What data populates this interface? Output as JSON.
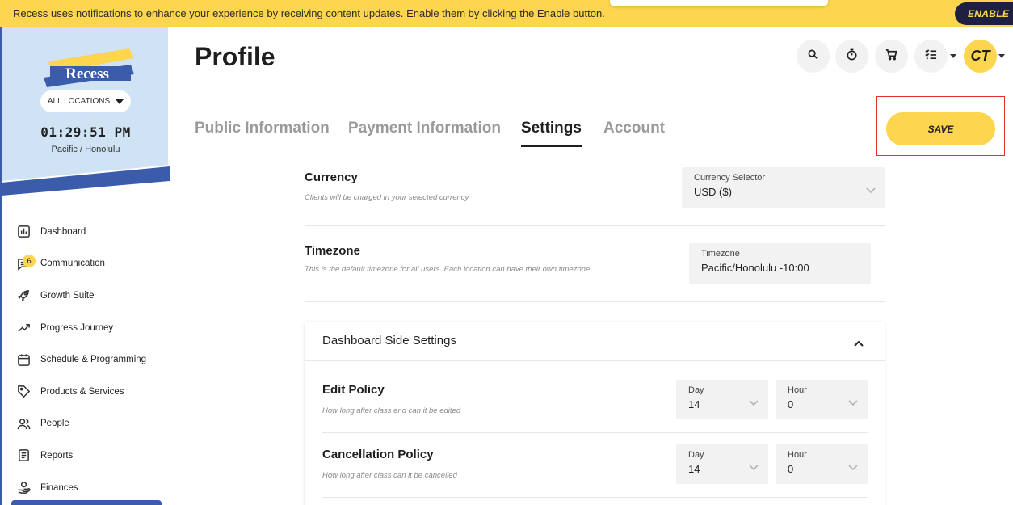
{
  "banner": {
    "message": "Recess uses notifications to enhance your experience by receiving content updates. Enable them by clicking the Enable button.",
    "enable_label": "ENABLE",
    "color": "#fdd54f"
  },
  "sidebar": {
    "logo_text": "Recess",
    "location_label": "ALL LOCATIONS",
    "clock": "01:29:51 PM",
    "timezone": "Pacific / Honolulu",
    "items": [
      {
        "label": "Dashboard",
        "icon": "chart-bar-icon"
      },
      {
        "label": "Communication",
        "icon": "message-icon",
        "badge": "6"
      },
      {
        "label": "Growth Suite",
        "icon": "rocket-icon"
      },
      {
        "label": "Progress Journey",
        "icon": "trend-up-icon"
      },
      {
        "label": "Schedule & Programming",
        "icon": "calendar-icon"
      },
      {
        "label": "Products & Services",
        "icon": "tag-icon"
      },
      {
        "label": "People",
        "icon": "people-icon"
      },
      {
        "label": "Reports",
        "icon": "report-icon"
      },
      {
        "label": "Finances",
        "icon": "finance-icon"
      }
    ]
  },
  "header": {
    "title": "Profile",
    "avatar_initials": "CT",
    "icons": [
      "search-icon",
      "timer-icon",
      "cart-icon",
      "tasks-icon"
    ]
  },
  "tabs": [
    {
      "label": "Public Information",
      "active": false
    },
    {
      "label": "Payment Information",
      "active": false
    },
    {
      "label": "Settings",
      "active": true
    },
    {
      "label": "Account",
      "active": false
    }
  ],
  "save_label": "SAVE",
  "settings": {
    "currency": {
      "title": "Currency",
      "description": "Clients will be charged in your selected currency",
      "field_label": "Currency Selector",
      "field_value": "USD ($)"
    },
    "timezone": {
      "title": "Timezone",
      "description": "This is the default timezone for all users. Each location can have their own timezone.",
      "field_label": "Timezone",
      "field_value": "Pacific/Honolulu -10:00"
    },
    "dashboard_side": {
      "title": "Dashboard Side Settings",
      "policies": [
        {
          "title": "Edit Policy",
          "description": "How long after class end can it be edited",
          "day_label": "Day",
          "day_value": "14",
          "hour_label": "Hour",
          "hour_value": "0"
        },
        {
          "title": "Cancellation Policy",
          "description": "How long after class can it be cancelled",
          "day_label": "Day",
          "day_value": "14",
          "hour_label": "Hour",
          "hour_value": "0"
        }
      ]
    }
  },
  "colors": {
    "accent_yellow": "#fdd54f",
    "brand_blue": "#3b5bab",
    "sidebar_bg": "#cfe3f5",
    "highlight_red": "#e03030"
  }
}
